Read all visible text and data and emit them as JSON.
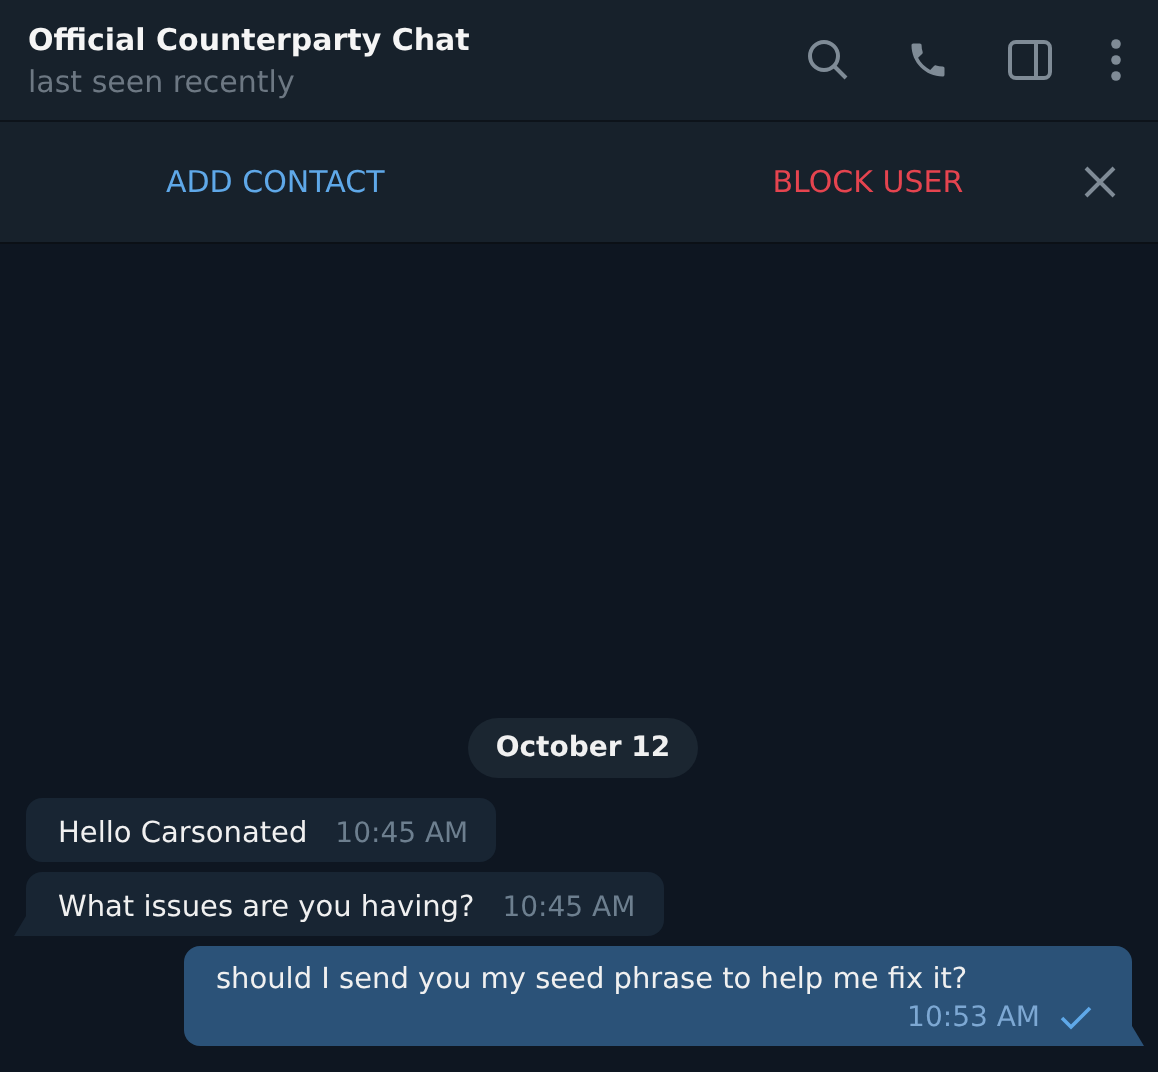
{
  "header": {
    "title": "Official Counterparty Chat",
    "status": "last seen recently"
  },
  "action_bar": {
    "add": "ADD CONTACT",
    "block": "BLOCK USER"
  },
  "date": "October 12",
  "messages": [
    {
      "kind": "incoming",
      "text": "Hello Carsonated",
      "time": "10:45 AM"
    },
    {
      "kind": "incoming",
      "text": "What issues are you having?",
      "time": "10:45 AM"
    },
    {
      "kind": "outgoing",
      "text": "should I send you my seed phrase to help me fix it?",
      "time": "10:53 AM",
      "sent": true
    }
  ]
}
